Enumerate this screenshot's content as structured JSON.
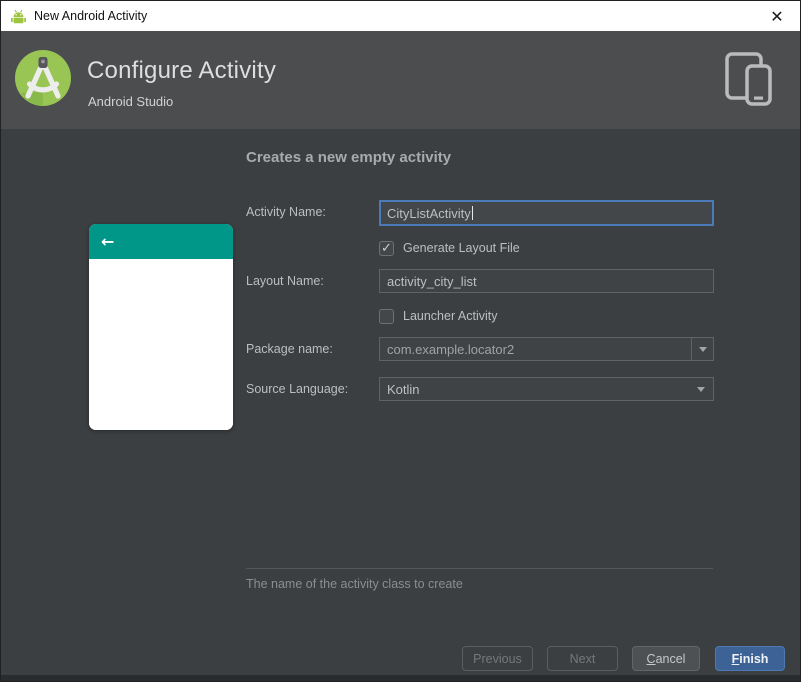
{
  "window": {
    "title": "New Android Activity",
    "close_glyph": "✕"
  },
  "header": {
    "title": "Configure Activity",
    "subtitle": "Android Studio"
  },
  "main": {
    "heading": "Creates a new empty activity",
    "preview": {
      "back_glyph": "←"
    },
    "form": {
      "activity_name": {
        "label": "Activity Name:",
        "value": "CityListActivity"
      },
      "generate_layout": {
        "label": "Generate Layout File",
        "checked": true
      },
      "layout_name": {
        "label": "Layout Name:",
        "value": "activity_city_list"
      },
      "launcher_activity": {
        "label": "Launcher Activity",
        "checked": false
      },
      "package_name": {
        "label": "Package name:",
        "value": "com.example.locator2"
      },
      "source_language": {
        "label": "Source Language:",
        "value": "Kotlin"
      }
    },
    "hint": "The name of the activity class to create"
  },
  "buttons": {
    "previous": "Previous",
    "next": "Next",
    "cancel": "Cancel",
    "finish": "Finish"
  },
  "colors": {
    "preview_teal": "#009688",
    "android_green": "#98C553",
    "finish_blue": "#3D6396",
    "focus_blue": "#4A7AB8"
  }
}
